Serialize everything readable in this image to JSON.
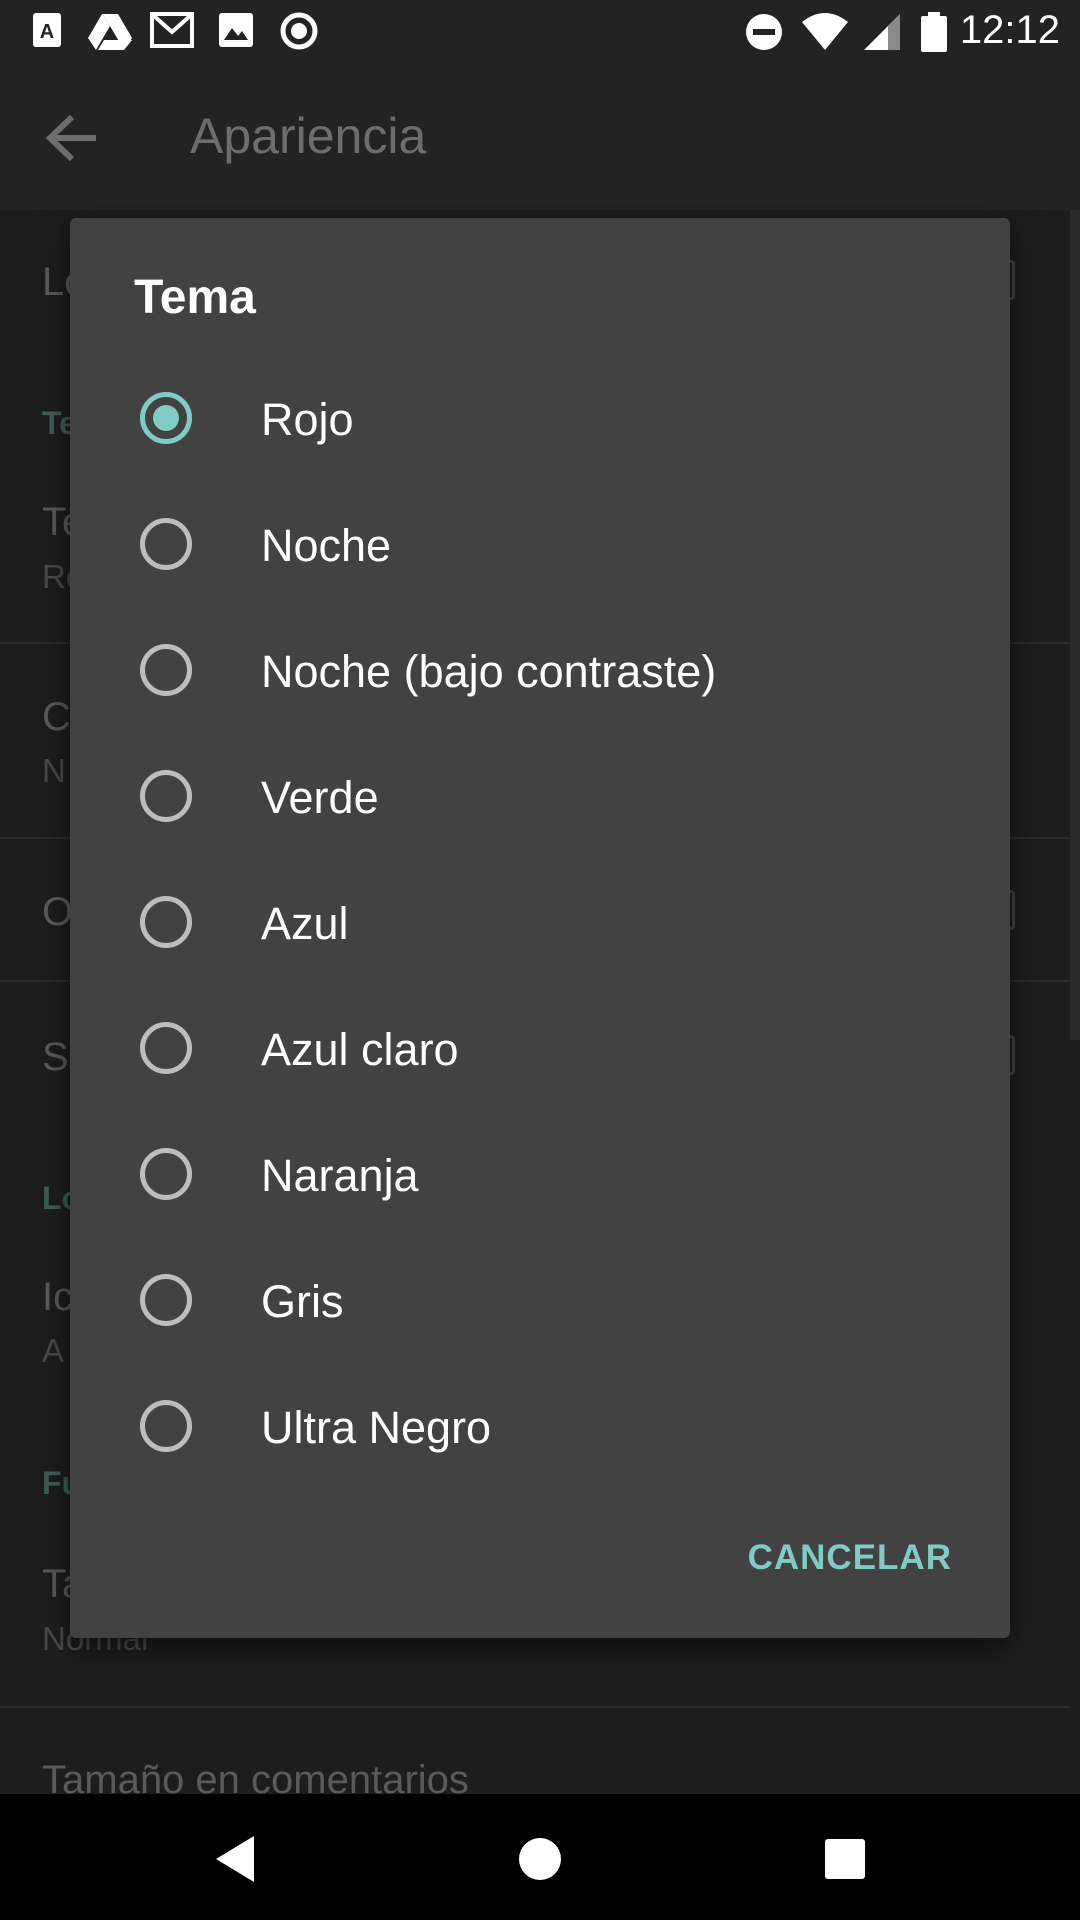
{
  "status_bar": {
    "time": "12:12",
    "left_icons": [
      "app-a-icon",
      "drive-icon",
      "gmail-icon",
      "photo-icon",
      "circle-dot-icon"
    ],
    "right_icons": [
      "dnd-icon",
      "wifi-icon",
      "signal-icon",
      "battery-icon"
    ]
  },
  "app_bar": {
    "title": "Apariencia",
    "back_icon": "arrow-left-icon"
  },
  "background_list": {
    "rows": [
      {
        "text": "Lo"
      },
      {
        "section": "Te"
      },
      {
        "text": "Te",
        "sub": "Ro"
      },
      {
        "text": "C",
        "sub": "N"
      },
      {
        "text": "O"
      },
      {
        "text": "S"
      },
      {
        "section": "Lo"
      },
      {
        "text": "Ic",
        "sub": "A"
      },
      {
        "section": "Fu"
      },
      {
        "text": "Ta",
        "sub": "Normal"
      },
      {
        "text": "Tamaño en comentarios"
      }
    ]
  },
  "dialog": {
    "title": "Tema",
    "options": [
      {
        "label": "Rojo",
        "selected": true
      },
      {
        "label": "Noche",
        "selected": false
      },
      {
        "label": "Noche (bajo contraste)",
        "selected": false
      },
      {
        "label": "Verde",
        "selected": false
      },
      {
        "label": "Azul",
        "selected": false
      },
      {
        "label": "Azul claro",
        "selected": false
      },
      {
        "label": "Naranja",
        "selected": false
      },
      {
        "label": "Gris",
        "selected": false
      },
      {
        "label": "Ultra Negro",
        "selected": false
      }
    ],
    "cancel_label": "CANCELAR",
    "accent_color": "#80cbc4"
  },
  "nav_bar": {
    "icons": [
      "back-triangle-icon",
      "home-circle-icon",
      "recents-square-icon"
    ]
  }
}
